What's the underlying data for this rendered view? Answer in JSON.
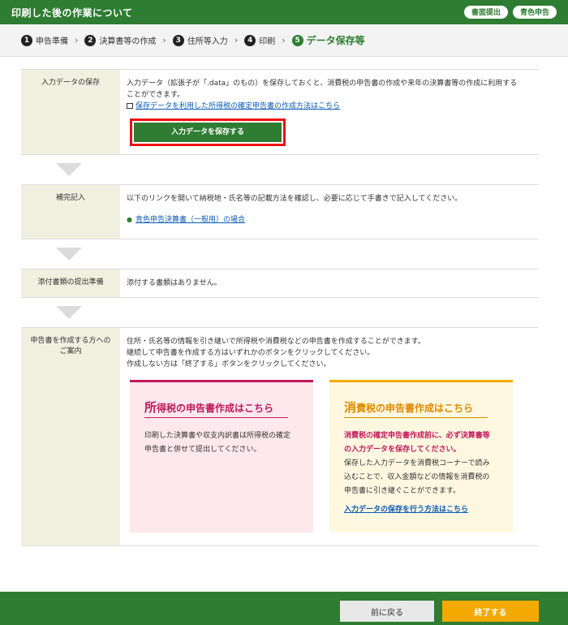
{
  "header": {
    "title": "印刷した後の作業について",
    "pill1": "書面提出",
    "pill2": "青色申告"
  },
  "steps": [
    {
      "num": "1",
      "label": "申告準備"
    },
    {
      "num": "2",
      "label": "決算書等の作成"
    },
    {
      "num": "3",
      "label": "住所等入力"
    },
    {
      "num": "4",
      "label": "印刷"
    },
    {
      "num": "5",
      "label": "データ保存等"
    }
  ],
  "rows": {
    "save": {
      "label": "入力データの保存",
      "text1": "入力データ（拡張子が「.data」のもの）を保存しておくと、消費税の申告書の作成や来年の決算書等の作成に利用する",
      "text2": "ことができます。",
      "link": "保存データを利用した所得税の確定申告書の作成方法はこちら",
      "button": "入力データを保存する"
    },
    "supplement": {
      "label": "補完記入",
      "text": "以下のリンクを開いて納税地・氏名等の記載方法を確認し、必要に応じて手書きで記入してください。",
      "link": "青色申告決算書（一般用）の場合"
    },
    "attach": {
      "label": "添付書類の提出準備",
      "text": "添付する書類はありません。"
    },
    "guide": {
      "label1": "申告書を作成する方への",
      "label2": "ご案内",
      "line1": "住所・氏名等の情報を引き継いで所得税や消費税などの申告書を作成することができます。",
      "line2": "継続して申告書を作成する方はいずれかのボタンをクリックしてください。",
      "line3": "作成しない方は「終了する」ボタンをクリックしてください。",
      "card1": {
        "title_big": "所",
        "title_rest": "得税の申告書作成はこちら",
        "body1": "印刷した決算書や収支内訳書は所得税の確定",
        "body2": "申告書と併せて提出してください。"
      },
      "card2": {
        "title_big": "消",
        "title_rest": "費税の申告書作成はこちら",
        "warn1": "消費税の確定申告書作成前に、必ず決算書等",
        "warn2": "の入力データを保存してください。",
        "body1": "保存した入力データを消費税コーナーで読み",
        "body2": "込むことで、収入金額などの情報を消費税の",
        "body3": "申告書に引き継ぐことができます。",
        "link": "入力データの保存を行う方法はこちら"
      }
    }
  },
  "footer": {
    "back": "前に戻る",
    "end": "終了する"
  },
  "colors": {
    "brand_green": "#2e7d32",
    "accent_orange": "#f4a900",
    "pink": "#c2185b",
    "highlight_red": "#e11"
  }
}
